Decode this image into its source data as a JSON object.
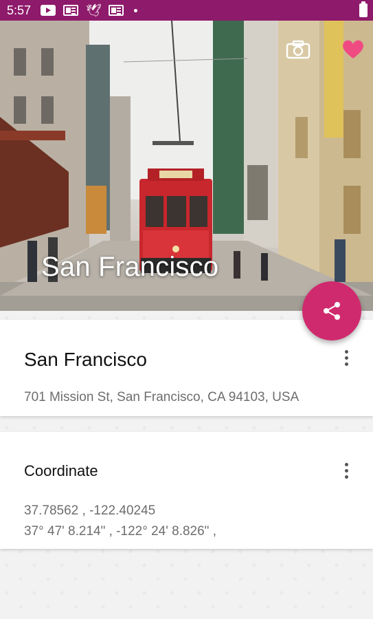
{
  "status_bar": {
    "time": "5:57",
    "background": "#8e1a6b",
    "icons": [
      "youtube-icon",
      "news-icon",
      "bird-icon",
      "news-icon",
      "dot-icon",
      "battery-icon"
    ]
  },
  "hero": {
    "title": "San Francisco",
    "camera_icon": "camera-icon",
    "favorite_icon": "heart-icon",
    "favorite_color": "#ef4b82"
  },
  "fab": {
    "icon": "share-icon",
    "color": "#d02a6e"
  },
  "place_card": {
    "title": "San Francisco",
    "address": "701 Mission St, San Francisco, CA 94103, USA",
    "menu_icon": "more-vert-icon"
  },
  "coordinate_card": {
    "title": "Coordinate",
    "decimal": "37.78562 , -122.40245",
    "dms": "37° 47' 8.214\" , -122° 24' 8.826\" ,",
    "menu_icon": "more-vert-icon"
  }
}
